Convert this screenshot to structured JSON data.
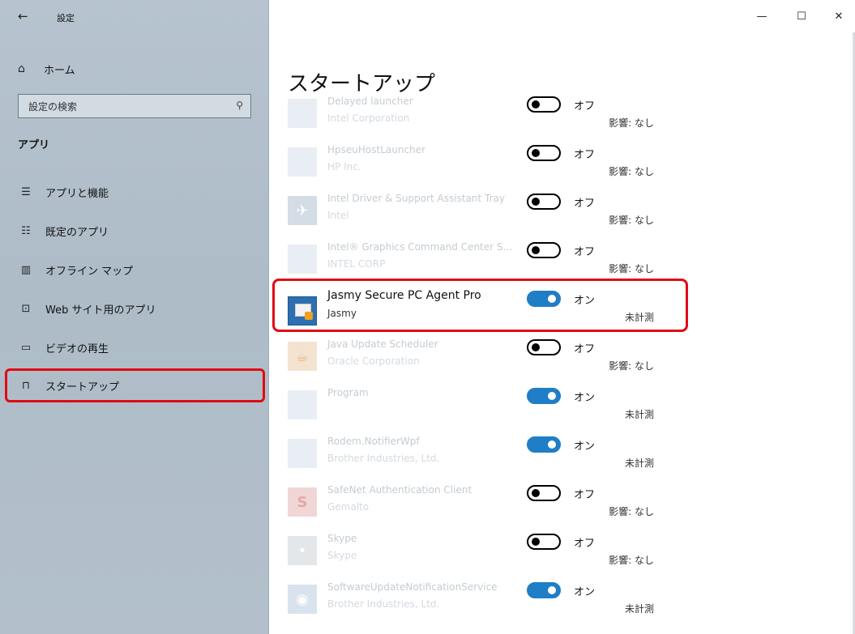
{
  "window": {
    "title": "設定",
    "controls": {
      "minimize": "—",
      "maximize": "☐",
      "close": "✕"
    }
  },
  "sidebar": {
    "back_icon": "←",
    "home": {
      "icon": "⌂",
      "label": "ホーム"
    },
    "search": {
      "placeholder": "設定の検索",
      "icon": "⚲"
    },
    "section_title": "アプリ",
    "items": [
      {
        "icon": "☰",
        "label": "アプリと機能"
      },
      {
        "icon": "☷",
        "label": "既定のアプリ"
      },
      {
        "icon": "▥",
        "label": "オフライン マップ"
      },
      {
        "icon": "⊡",
        "label": "Web サイト用のアプリ"
      },
      {
        "icon": "▭",
        "label": "ビデオの再生"
      },
      {
        "icon": "⊓",
        "label": "スタートアップ"
      }
    ]
  },
  "main": {
    "title": "スタートアップ",
    "apps": [
      {
        "name": "Delayed launcher",
        "publisher": "Intel Corporation",
        "enabled": false,
        "state": "オフ",
        "impact": "影響: なし",
        "icon": ""
      },
      {
        "name": "HpseuHostLauncher",
        "publisher": "HP Inc.",
        "enabled": false,
        "state": "オフ",
        "impact": "影響: なし",
        "icon": ""
      },
      {
        "name": "Intel Driver & Support Assistant Tray",
        "publisher": "Intel",
        "enabled": false,
        "state": "オフ",
        "impact": "影響: なし",
        "icon": "✈"
      },
      {
        "name": "Intel® Graphics Command Center S...",
        "publisher": "INTEL CORP",
        "enabled": false,
        "state": "オフ",
        "impact": "影響: なし",
        "icon": ""
      },
      {
        "name": "Jasmy Secure PC Agent Pro",
        "publisher": "Jasmy",
        "enabled": true,
        "state": "オン",
        "impact": "未計測",
        "icon": ""
      },
      {
        "name": "Java Update Scheduler",
        "publisher": "Oracle Corporation",
        "enabled": false,
        "state": "オフ",
        "impact": "影響: なし",
        "icon": "☕"
      },
      {
        "name": "Program",
        "publisher": "",
        "enabled": true,
        "state": "オン",
        "impact": "未計測",
        "icon": ""
      },
      {
        "name": "Rodem.NotifierWpf",
        "publisher": "Brother Industries, Ltd.",
        "enabled": true,
        "state": "オン",
        "impact": "未計測",
        "icon": ""
      },
      {
        "name": "SafeNet Authentication Client",
        "publisher": "Gemalto",
        "enabled": false,
        "state": "オフ",
        "impact": "影響: なし",
        "icon": "S"
      },
      {
        "name": "Skype",
        "publisher": "Skype",
        "enabled": false,
        "state": "オフ",
        "impact": "影響: なし",
        "icon": "•"
      },
      {
        "name": "SoftwareUpdateNotificationService",
        "publisher": "Brother Industries, Ltd.",
        "enabled": true,
        "state": "オン",
        "impact": "未計測",
        "icon": "◉"
      }
    ]
  },
  "colors": {
    "accent": "#1f7ec6",
    "highlight": "#e00a14",
    "sidebar": "#b3c0cb"
  }
}
